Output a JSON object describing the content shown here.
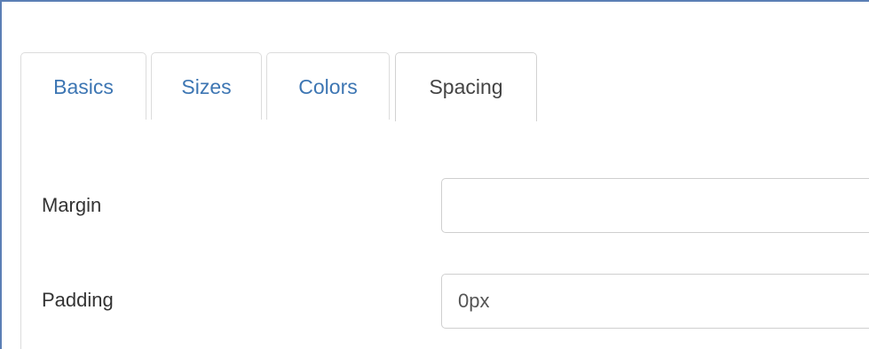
{
  "tabs": [
    {
      "label": "Basics",
      "active": false
    },
    {
      "label": "Sizes",
      "active": false
    },
    {
      "label": "Colors",
      "active": false
    },
    {
      "label": "Spacing",
      "active": true
    }
  ],
  "fields": {
    "margin": {
      "label": "Margin",
      "value": ""
    },
    "padding": {
      "label": "Padding",
      "value": "0px"
    }
  },
  "colors": {
    "tab_link": "#3d76b3",
    "tab_active_text": "#444444",
    "frame_border": "#5b7fb5"
  }
}
